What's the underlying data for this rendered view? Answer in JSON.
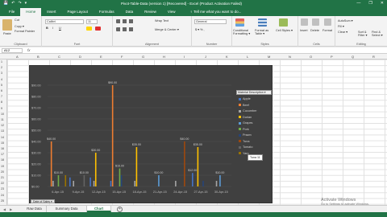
{
  "window": {
    "title": "Pivot-Table-Data (version 1) [Recovered] - Excel (Product Activation Failed)",
    "quick_access": [
      "💾",
      "↶",
      "↷",
      "▾"
    ],
    "buttons": [
      "—",
      "❐",
      "✕"
    ]
  },
  "ribbon_tabs": [
    "File",
    "Home",
    "Insert",
    "Page Layout",
    "Formulas",
    "Data",
    "Review",
    "View"
  ],
  "tell_me": "♀ Tell me what you want to do...",
  "ribbon": {
    "clipboard": {
      "cut": "Cut",
      "copy": "Copy ▾",
      "format_painter": "Format Painter",
      "paste": "Paste",
      "label": "Clipboard"
    },
    "font": {
      "name": "Calibri",
      "size": "11",
      "label": "Font",
      "bold": "B",
      "italic": "I",
      "underline": "U"
    },
    "alignment": {
      "wrap": "Wrap Text",
      "merge": "Merge & Center ▾",
      "label": "Alignment"
    },
    "number": {
      "format": "General",
      "currency": "$ ▾ % ,",
      "label": "Number"
    },
    "styles": {
      "conditional": "Conditional Formatting ▾",
      "format_table": "Format as Table ▾",
      "cell_styles": "Cell Styles ▾",
      "label": "Styles"
    },
    "cells": {
      "insert": "Insert",
      "delete": "Delete",
      "format": "Format",
      "label": "Cells"
    },
    "editing": {
      "autosum": "AutoSum ▾",
      "fill": "Fill ▾",
      "clear": "Clear ▾",
      "sort": "Sort & Filter ▾",
      "find": "Find & Select ▾",
      "label": "Editing"
    }
  },
  "name_box": "A12",
  "fx": "fx",
  "columns": [
    "A",
    "B",
    "C",
    "D",
    "E",
    "F",
    "G",
    "H",
    "I",
    "J",
    "K",
    "L",
    "M",
    "N",
    "O",
    "P",
    "Q",
    "R",
    "S"
  ],
  "rows": [
    "1",
    "2",
    "3",
    "4",
    "5",
    "6",
    "7",
    "8",
    "9",
    "10",
    "11",
    "12",
    "13",
    "14",
    "15",
    "16",
    "17",
    "18",
    "19",
    "20",
    "21",
    "22",
    "23",
    "24",
    "25"
  ],
  "chart_data": {
    "type": "bar",
    "categories": [
      "6-Apr-15",
      "9-Apr-15",
      "12-Apr-15",
      "15-Apr-15",
      "18-Apr-15",
      "21-Apr-15",
      "24-Apr-15",
      "27-Apr-15",
      "30-Apr-15"
    ],
    "ylim": [
      0,
      100
    ],
    "yticks": [
      "$0.00",
      "$10.00",
      "$20.00",
      "$30.00",
      "$40.00",
      "$50.00",
      "$60.00",
      "$70.00",
      "$80.00",
      "$90.00"
    ],
    "series": [
      {
        "name": "Apple",
        "color": "#4472c4",
        "values": [
          0,
          8,
          8,
          5,
          0,
          0,
          0,
          12,
          0
        ]
      },
      {
        "name": "Beef",
        "color": "#ed7d31",
        "values": [
          40,
          0,
          0,
          90,
          0,
          0,
          0,
          0,
          0
        ]
      },
      {
        "name": "Cucumber",
        "color": "#a5a5a5",
        "values": [
          5,
          5,
          5,
          0,
          5,
          0,
          5,
          0,
          5
        ]
      },
      {
        "name": "Durian",
        "color": "#ffc000",
        "values": [
          0,
          0,
          30,
          0,
          35,
          0,
          0,
          35,
          0
        ]
      },
      {
        "name": "Grapes",
        "color": "#5b9bd5",
        "values": [
          0,
          0,
          0,
          0,
          0,
          10,
          0,
          0,
          10
        ]
      },
      {
        "name": "Pork",
        "color": "#70ad47",
        "values": [
          10,
          0,
          0,
          16,
          0,
          0,
          0,
          0,
          0
        ]
      },
      {
        "name": "Prawn",
        "color": "#264478",
        "values": [
          0,
          0,
          0,
          10,
          0,
          0,
          0,
          5,
          0
        ]
      },
      {
        "name": "Tuna",
        "color": "#9e480e",
        "values": [
          0,
          0,
          0,
          0,
          0,
          0,
          40,
          0,
          0
        ]
      },
      {
        "name": "Tomato",
        "color": "#636363",
        "values": [
          0,
          10,
          0,
          0,
          0,
          0,
          0,
          0,
          0
        ]
      },
      {
        "name": "Yam",
        "color": "#997300",
        "values": [
          10,
          0,
          0,
          0,
          0,
          0,
          0,
          0,
          0
        ]
      }
    ],
    "labels_shown": [
      {
        "cat": 0,
        "series": 1,
        "text": "$40.00"
      },
      {
        "cat": 0,
        "series": 5,
        "text": "$10.00"
      },
      {
        "cat": 1,
        "series": 8,
        "text": "$10.00"
      },
      {
        "cat": 2,
        "series": 3,
        "text": "$30.00"
      },
      {
        "cat": 3,
        "series": 1,
        "text": "$90.00"
      },
      {
        "cat": 3,
        "series": 5,
        "text": "$16.00"
      },
      {
        "cat": 4,
        "series": 3,
        "text": "$35.00"
      },
      {
        "cat": 5,
        "series": 4,
        "text": "$10.00"
      },
      {
        "cat": 6,
        "series": 7,
        "text": "$40.00"
      },
      {
        "cat": 7,
        "series": 3,
        "text": "$35.00"
      },
      {
        "cat": 7,
        "series": 0,
        "text": "$12.00"
      },
      {
        "cat": 8,
        "series": 4,
        "text": "$10.00"
      }
    ],
    "legend_title": "Material Description ▾",
    "legend_placement": "right",
    "filter_button": "Date of Sales ▾"
  },
  "tooltip": "Tuna 11",
  "sheet_tabs": [
    "Raw Data",
    "Summary Data",
    "Chart"
  ],
  "active_sheet": "Chart",
  "sheet_nav": [
    "◀",
    "▶"
  ],
  "add_sheet": "+",
  "watermark": {
    "line1": "Activate Windows",
    "line2": "Go to Settings to activate Windows."
  },
  "colors": {
    "excel_green": "#217346",
    "chart_bg": "#404040"
  }
}
